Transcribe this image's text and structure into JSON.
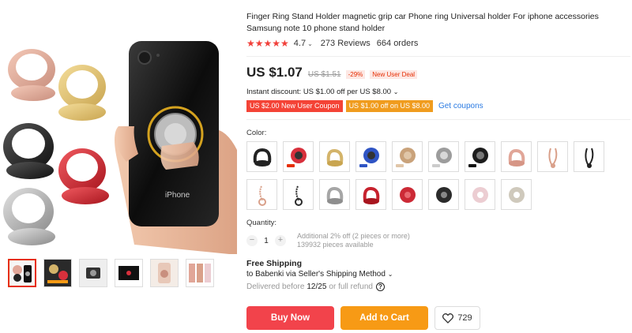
{
  "product": {
    "title": "Finger Ring Stand Holder magnetic grip car Phone ring Universal holder For iphone accessories Samsung note 10 phone stand holder",
    "rating": "4.7",
    "reviews": "273 Reviews",
    "orders": "664 orders",
    "stars_icon": "star-rating-icon"
  },
  "price": {
    "current": "US $1.07",
    "original": "US $1.51",
    "discount": "-29%",
    "deal_badge": "New User Deal"
  },
  "promo": {
    "instant_discount": "Instant discount: US $1.00 off per US $8.00",
    "coupons": [
      "US $2.00 New User Coupon",
      "US $1.00 off on US $8.00"
    ],
    "get_coupons": "Get coupons"
  },
  "variants": {
    "label": "Color:",
    "swatch_colors": [
      "#222222",
      "#d8303c",
      "#d4b46a",
      "#2f54c4",
      "#c9a27a",
      "#9c9c9c",
      "#1c1c1c",
      "#e1a698",
      "#d9a08a",
      "#222222",
      "#d9a08a",
      "#2a2a2a",
      "#a6a6a6",
      "#c7222e",
      "#cc2a36",
      "#2b2b2b",
      "#eccdd2",
      "#cfc9bc"
    ]
  },
  "quantity": {
    "label": "Quantity:",
    "value": "1",
    "minus": "−",
    "plus": "+",
    "note_line1": "Additional 2% off (2 pieces or more)",
    "note_line2": "139932 pieces available"
  },
  "shipping": {
    "title": "Free Shipping",
    "to": "to Babenki via Seller's Shipping Method",
    "delivered_prefix": "Delivered before",
    "delivered_date": "12/25",
    "delivered_suffix": "or full refund",
    "help": "?"
  },
  "actions": {
    "buy_now": "Buy Now",
    "add_to_cart": "Add to Cart",
    "wishlist_count": "729"
  },
  "gallery": {
    "phone_label": "iPhone"
  },
  "colors": {
    "accent_red": "#f2434b",
    "accent_orange": "#f79a15",
    "link_blue": "#2a7ae2",
    "star_red": "#f1403a"
  }
}
